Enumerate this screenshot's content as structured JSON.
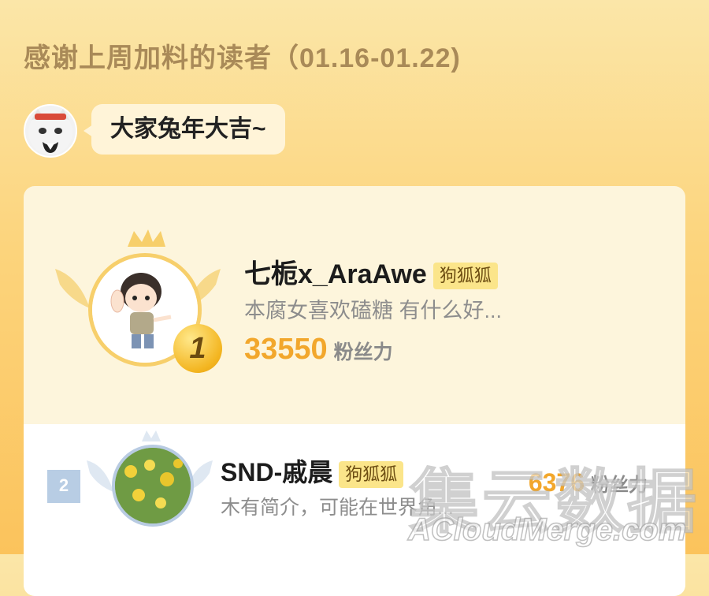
{
  "header": {
    "title": "感谢上周加料的读者（01.16-01.22)"
  },
  "greeting": {
    "text": "大家兔年大吉~"
  },
  "ranking": [
    {
      "rank": "1",
      "name": "七栀x_AraAwe",
      "tag": "狗狐狐",
      "bio": "本腐女喜欢磕糖 有什么好...",
      "fans": "33550",
      "fans_unit": "粉丝力"
    },
    {
      "rank": "2",
      "name": "SND-戚晨",
      "tag": "狗狐狐",
      "bio": "木有简介，可能在世界角...",
      "fans": "6376",
      "fans_unit": "粉丝力"
    }
  ],
  "watermark": {
    "cn": "集云数据",
    "en": "ACloudMerge.com"
  },
  "colors": {
    "accent": "#f2a72c",
    "gold": "#f3b520",
    "tag_bg": "#fbe58a",
    "rank2": "#b8cde4"
  }
}
